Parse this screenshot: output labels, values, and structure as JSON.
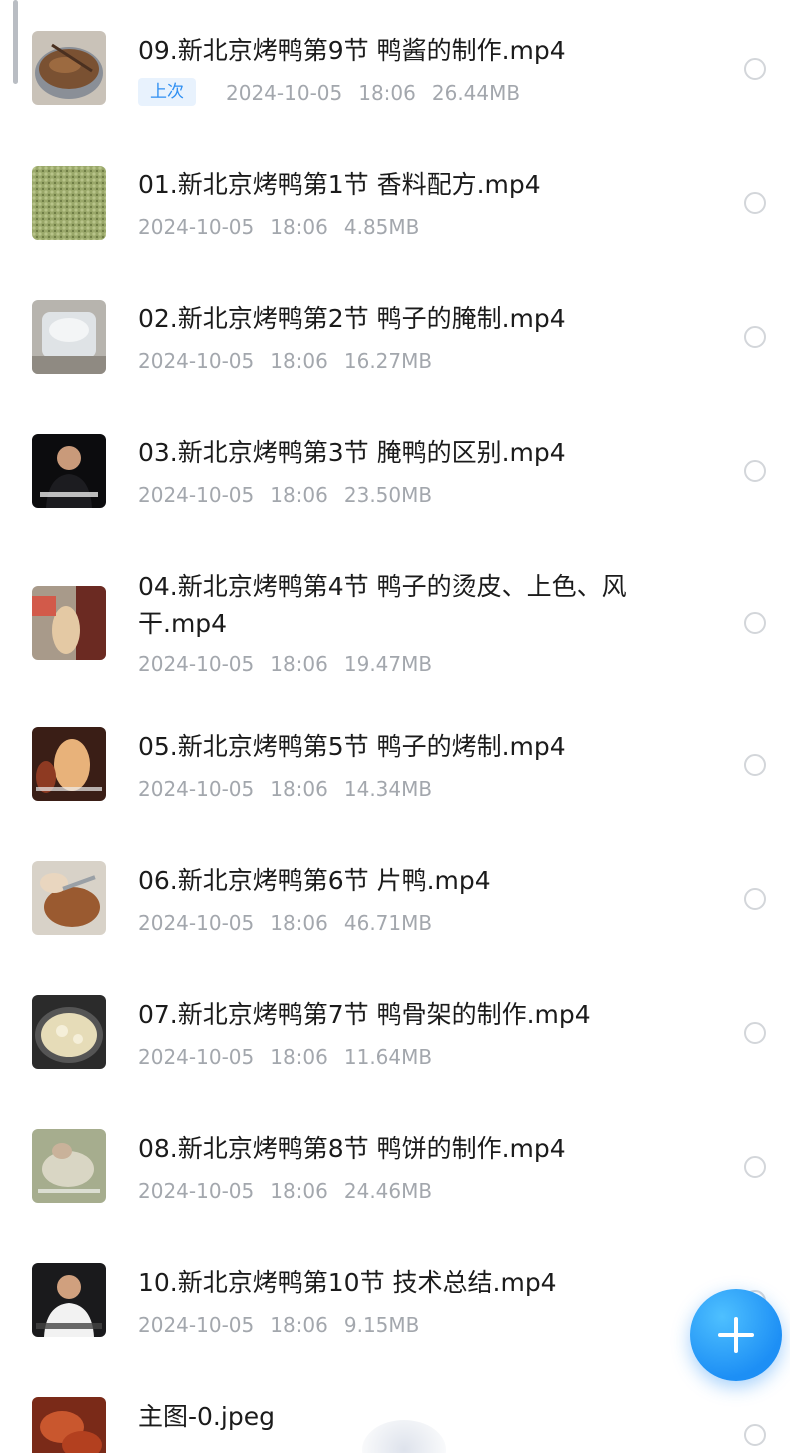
{
  "files": [
    {
      "name": "09.新北京烤鸭第9节 鸭酱的制作.mp4",
      "badge": "上次",
      "date": "2024-10-05",
      "time": "18:06",
      "size": "26.44MB",
      "thumb": "sauce-pot-thumbnail"
    },
    {
      "name": "01.新北京烤鸭第1节 香料配方.mp4",
      "badge": "",
      "date": "2024-10-05",
      "time": "18:06",
      "size": "4.85MB",
      "thumb": "spices-thumbnail"
    },
    {
      "name": "02.新北京烤鸭第2节 鸭子的腌制.mp4",
      "badge": "",
      "date": "2024-10-05",
      "time": "18:06",
      "size": "16.27MB",
      "thumb": "marinade-bowl-thumbnail"
    },
    {
      "name": "03.新北京烤鸭第3节 腌鸭的区别.mp4",
      "badge": "",
      "date": "2024-10-05",
      "time": "18:06",
      "size": "23.50MB",
      "thumb": "presenter-thumbnail"
    },
    {
      "name": "04.新北京烤鸭第4节 鸭子的烫皮、上色、风干.mp4",
      "badge": "",
      "date": "2024-10-05",
      "time": "18:06",
      "size": "19.47MB",
      "thumb": "hanging-duck-thumbnail"
    },
    {
      "name": "05.新北京烤鸭第5节 鸭子的烤制.mp4",
      "badge": "",
      "date": "2024-10-05",
      "time": "18:06",
      "size": "14.34MB",
      "thumb": "roasted-duck-thumbnail"
    },
    {
      "name": "06.新北京烤鸭第6节 片鸭.mp4",
      "badge": "",
      "date": "2024-10-05",
      "time": "18:06",
      "size": "46.71MB",
      "thumb": "slicing-duck-thumbnail"
    },
    {
      "name": "07.新北京烤鸭第7节 鸭骨架的制作.mp4",
      "badge": "",
      "date": "2024-10-05",
      "time": "18:06",
      "size": "11.64MB",
      "thumb": "frying-pot-thumbnail"
    },
    {
      "name": "08.新北京烤鸭第8节 鸭饼的制作.mp4",
      "badge": "",
      "date": "2024-10-05",
      "time": "18:06",
      "size": "24.46MB",
      "thumb": "pancake-dough-thumbnail"
    },
    {
      "name": "10.新北京烤鸭第10节 技术总结.mp4",
      "badge": "",
      "date": "2024-10-05",
      "time": "18:06",
      "size": "9.15MB",
      "thumb": "chef-summary-thumbnail"
    },
    {
      "name": "主图-0.jpeg",
      "badge": "",
      "date": "",
      "time": "",
      "size": "",
      "thumb": "duck-main-image-thumbnail"
    }
  ],
  "fab": {
    "icon": "plus-icon"
  },
  "colors": {
    "accent": "#1d8ff5",
    "meta_text": "#a3a7ad",
    "badge_bg": "#e8f2fd",
    "badge_text": "#2f8ff2"
  }
}
